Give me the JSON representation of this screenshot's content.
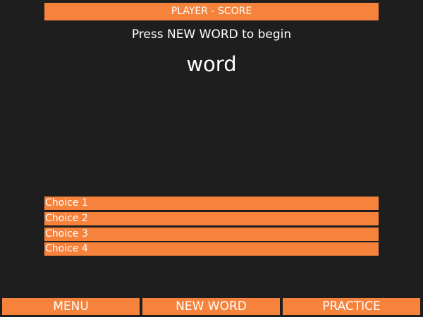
{
  "header": {
    "score_text": "PLAYER - SCORE"
  },
  "main": {
    "prompt": "Press NEW WORD to begin",
    "word": "word"
  },
  "choices": [
    {
      "label": "Choice 1"
    },
    {
      "label": "Choice 2"
    },
    {
      "label": "Choice 3"
    },
    {
      "label": "Choice 4"
    }
  ],
  "footer": {
    "menu_label": "MENU",
    "new_word_label": "NEW WORD",
    "practice_label": "PRACTICE"
  },
  "colors": {
    "background": "#1e1e1e",
    "accent": "#f6823c",
    "text": "#ffffff"
  }
}
